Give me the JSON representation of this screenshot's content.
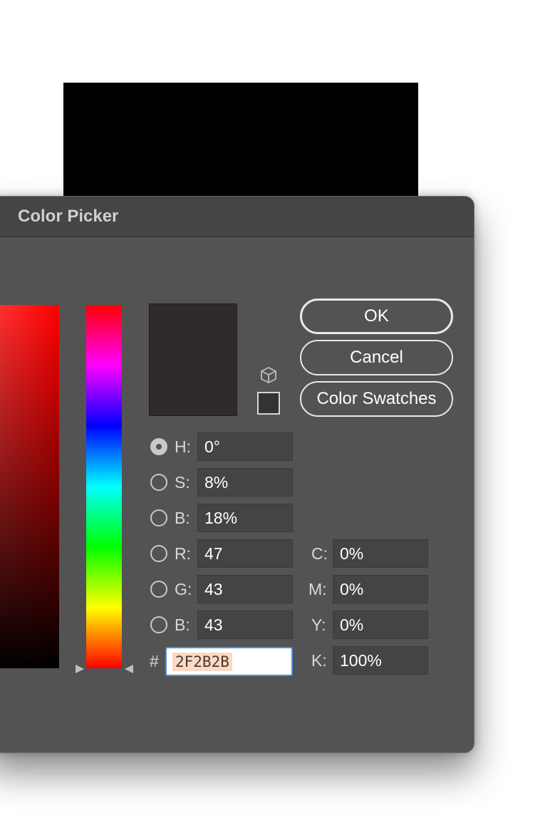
{
  "dialog": {
    "title": "Color Picker"
  },
  "buttons": {
    "ok": "OK",
    "cancel": "Cancel",
    "swatches": "Color Swatches"
  },
  "hsb": [
    {
      "label": "H:",
      "value": "0°",
      "selected": true
    },
    {
      "label": "S:",
      "value": "8%"
    },
    {
      "label": "B:",
      "value": "18%"
    }
  ],
  "rgb": [
    {
      "label": "R:",
      "value": "47"
    },
    {
      "label": "G:",
      "value": "43"
    },
    {
      "label": "B:",
      "value": "43"
    }
  ],
  "cmyk": [
    {
      "label": "C:",
      "value": "0%"
    },
    {
      "label": "M:",
      "value": "0%"
    },
    {
      "label": "Y:",
      "value": "0%"
    },
    {
      "label": "K:",
      "value": "100%"
    }
  ],
  "hex": {
    "label": "#",
    "value": "2F2B2B"
  },
  "colors": {
    "current": "#2f2b2b",
    "dialog_bg": "#535353",
    "field_bg": "#444444"
  },
  "icons": {
    "websafe": "cube-icon"
  }
}
